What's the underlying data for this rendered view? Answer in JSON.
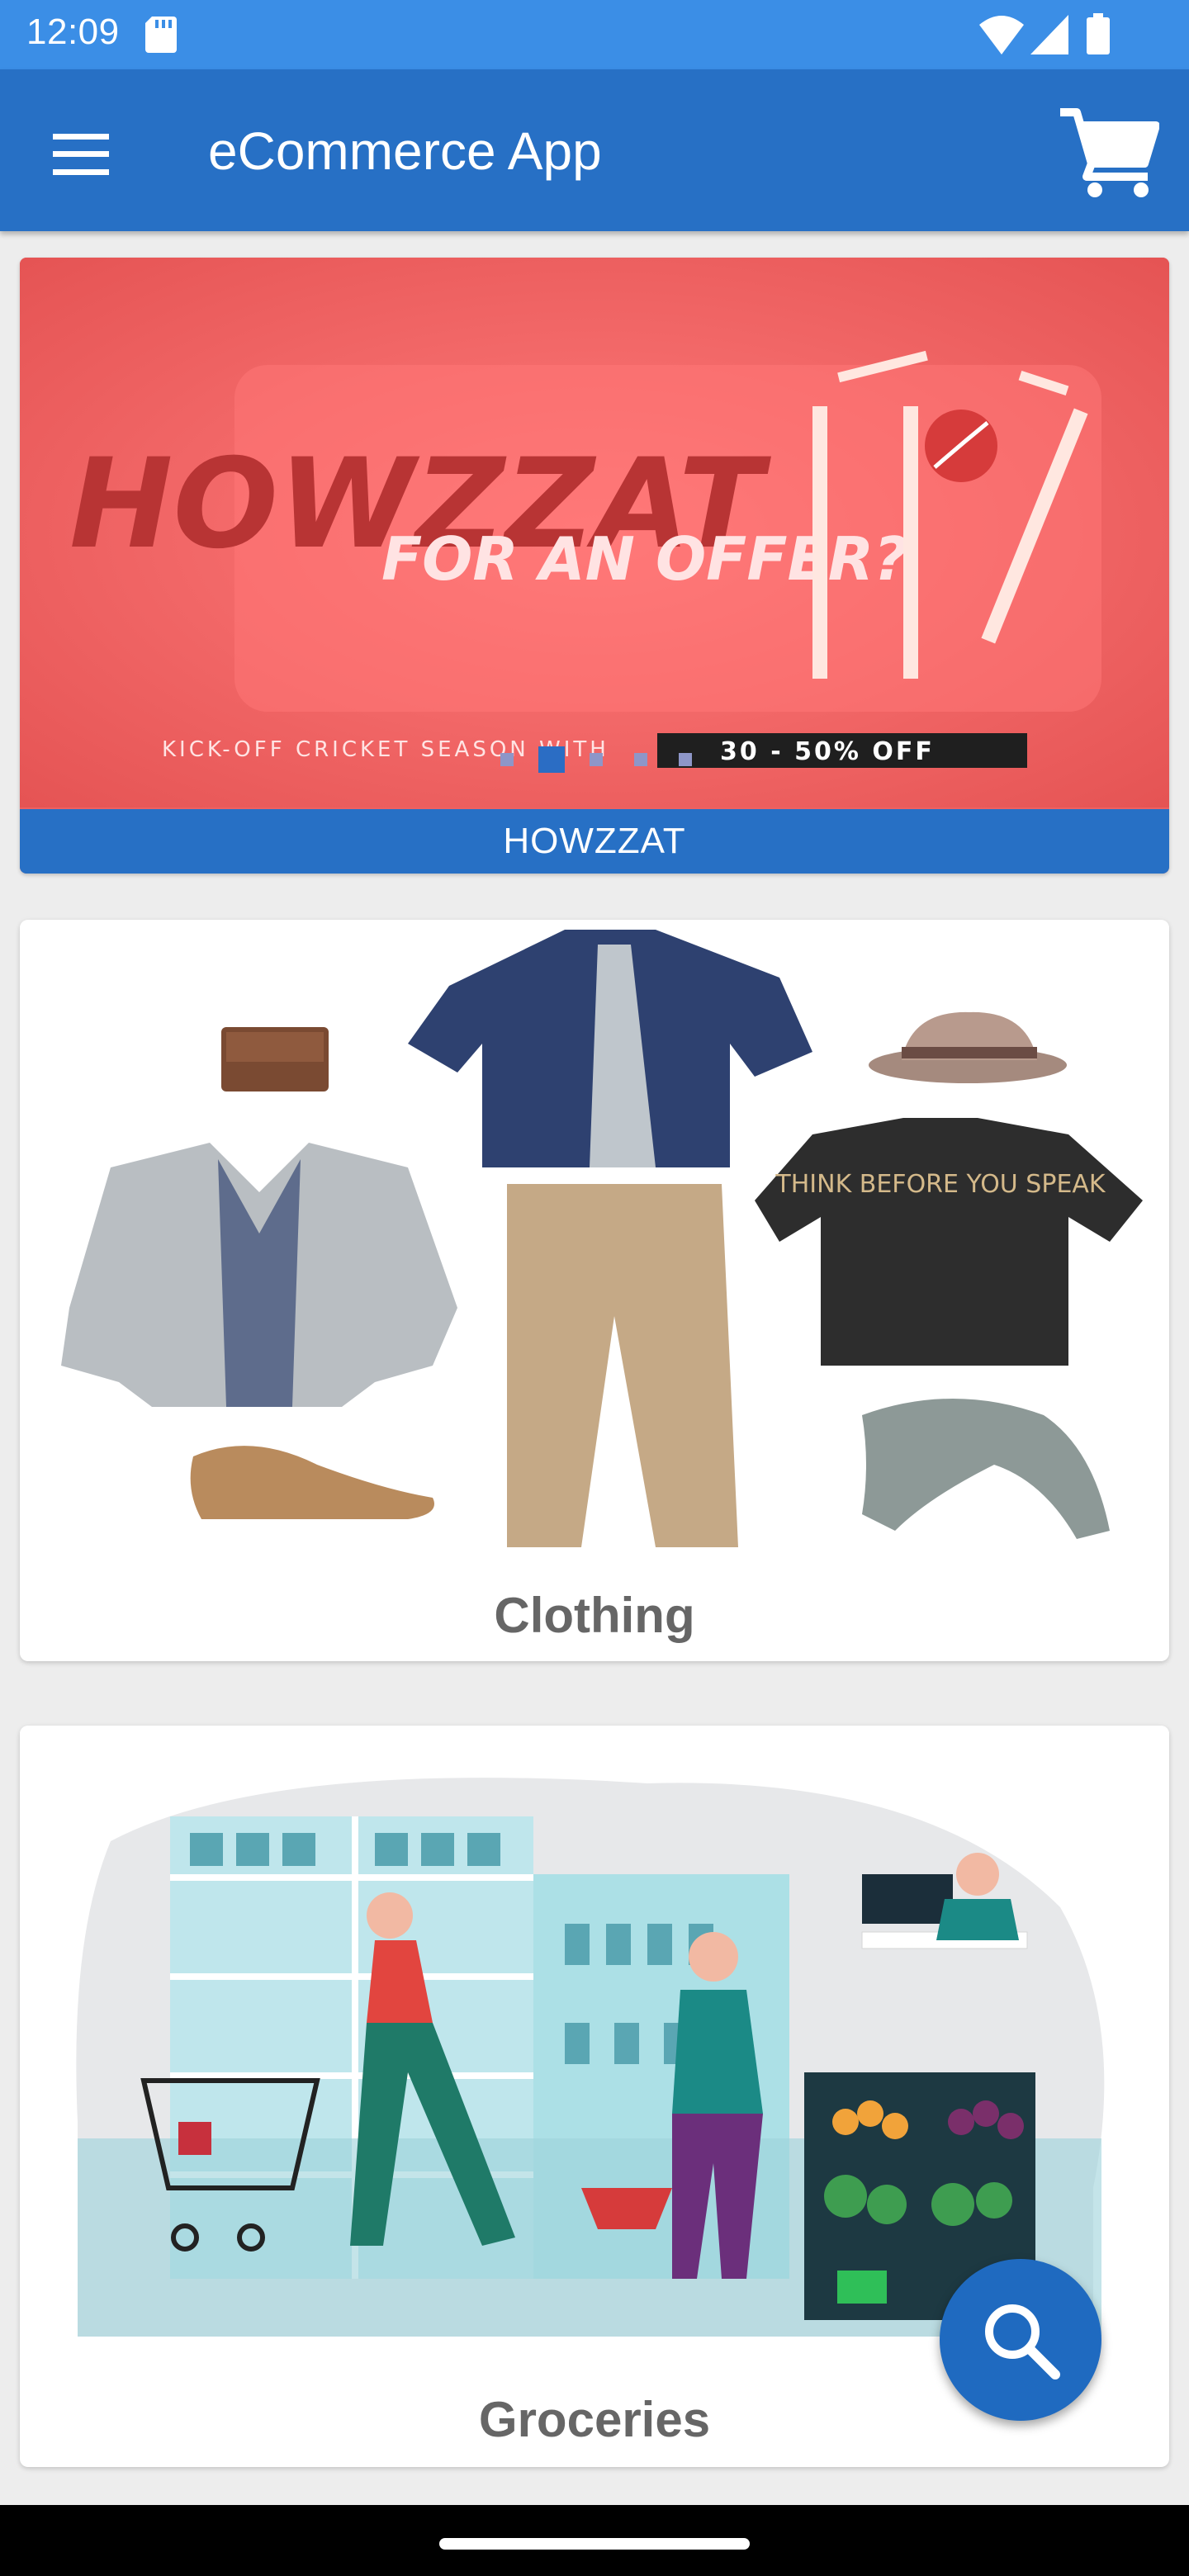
{
  "status_bar": {
    "time": "12:09"
  },
  "app_bar": {
    "title": "eCommerce App"
  },
  "banner": {
    "headline": "HOWZZAT",
    "subline": "FOR AN OFFER?",
    "tagline": "KICK-OFF CRICKET SEASON WITH",
    "offer": "30 - 50% OFF",
    "caption": "HOWZZAT",
    "carousel": {
      "count": 5,
      "active_index": 1
    }
  },
  "categories": [
    {
      "label": "Clothing",
      "shirt_text": "THINK BEFORE YOU SPEAK"
    },
    {
      "label": "Groceries"
    }
  ],
  "colors": {
    "status_bar": "#3b8ee6",
    "app_bar": "#2770c5",
    "banner_bg": "#ee6161",
    "fab": "#1f6ac0",
    "card_label": "#666666"
  },
  "icons": {
    "menu": "menu-icon",
    "cart": "cart-icon",
    "search": "search-icon",
    "wifi": "wifi-icon",
    "signal": "signal-icon",
    "battery": "battery-icon",
    "sd_card": "sd-card-icon"
  }
}
